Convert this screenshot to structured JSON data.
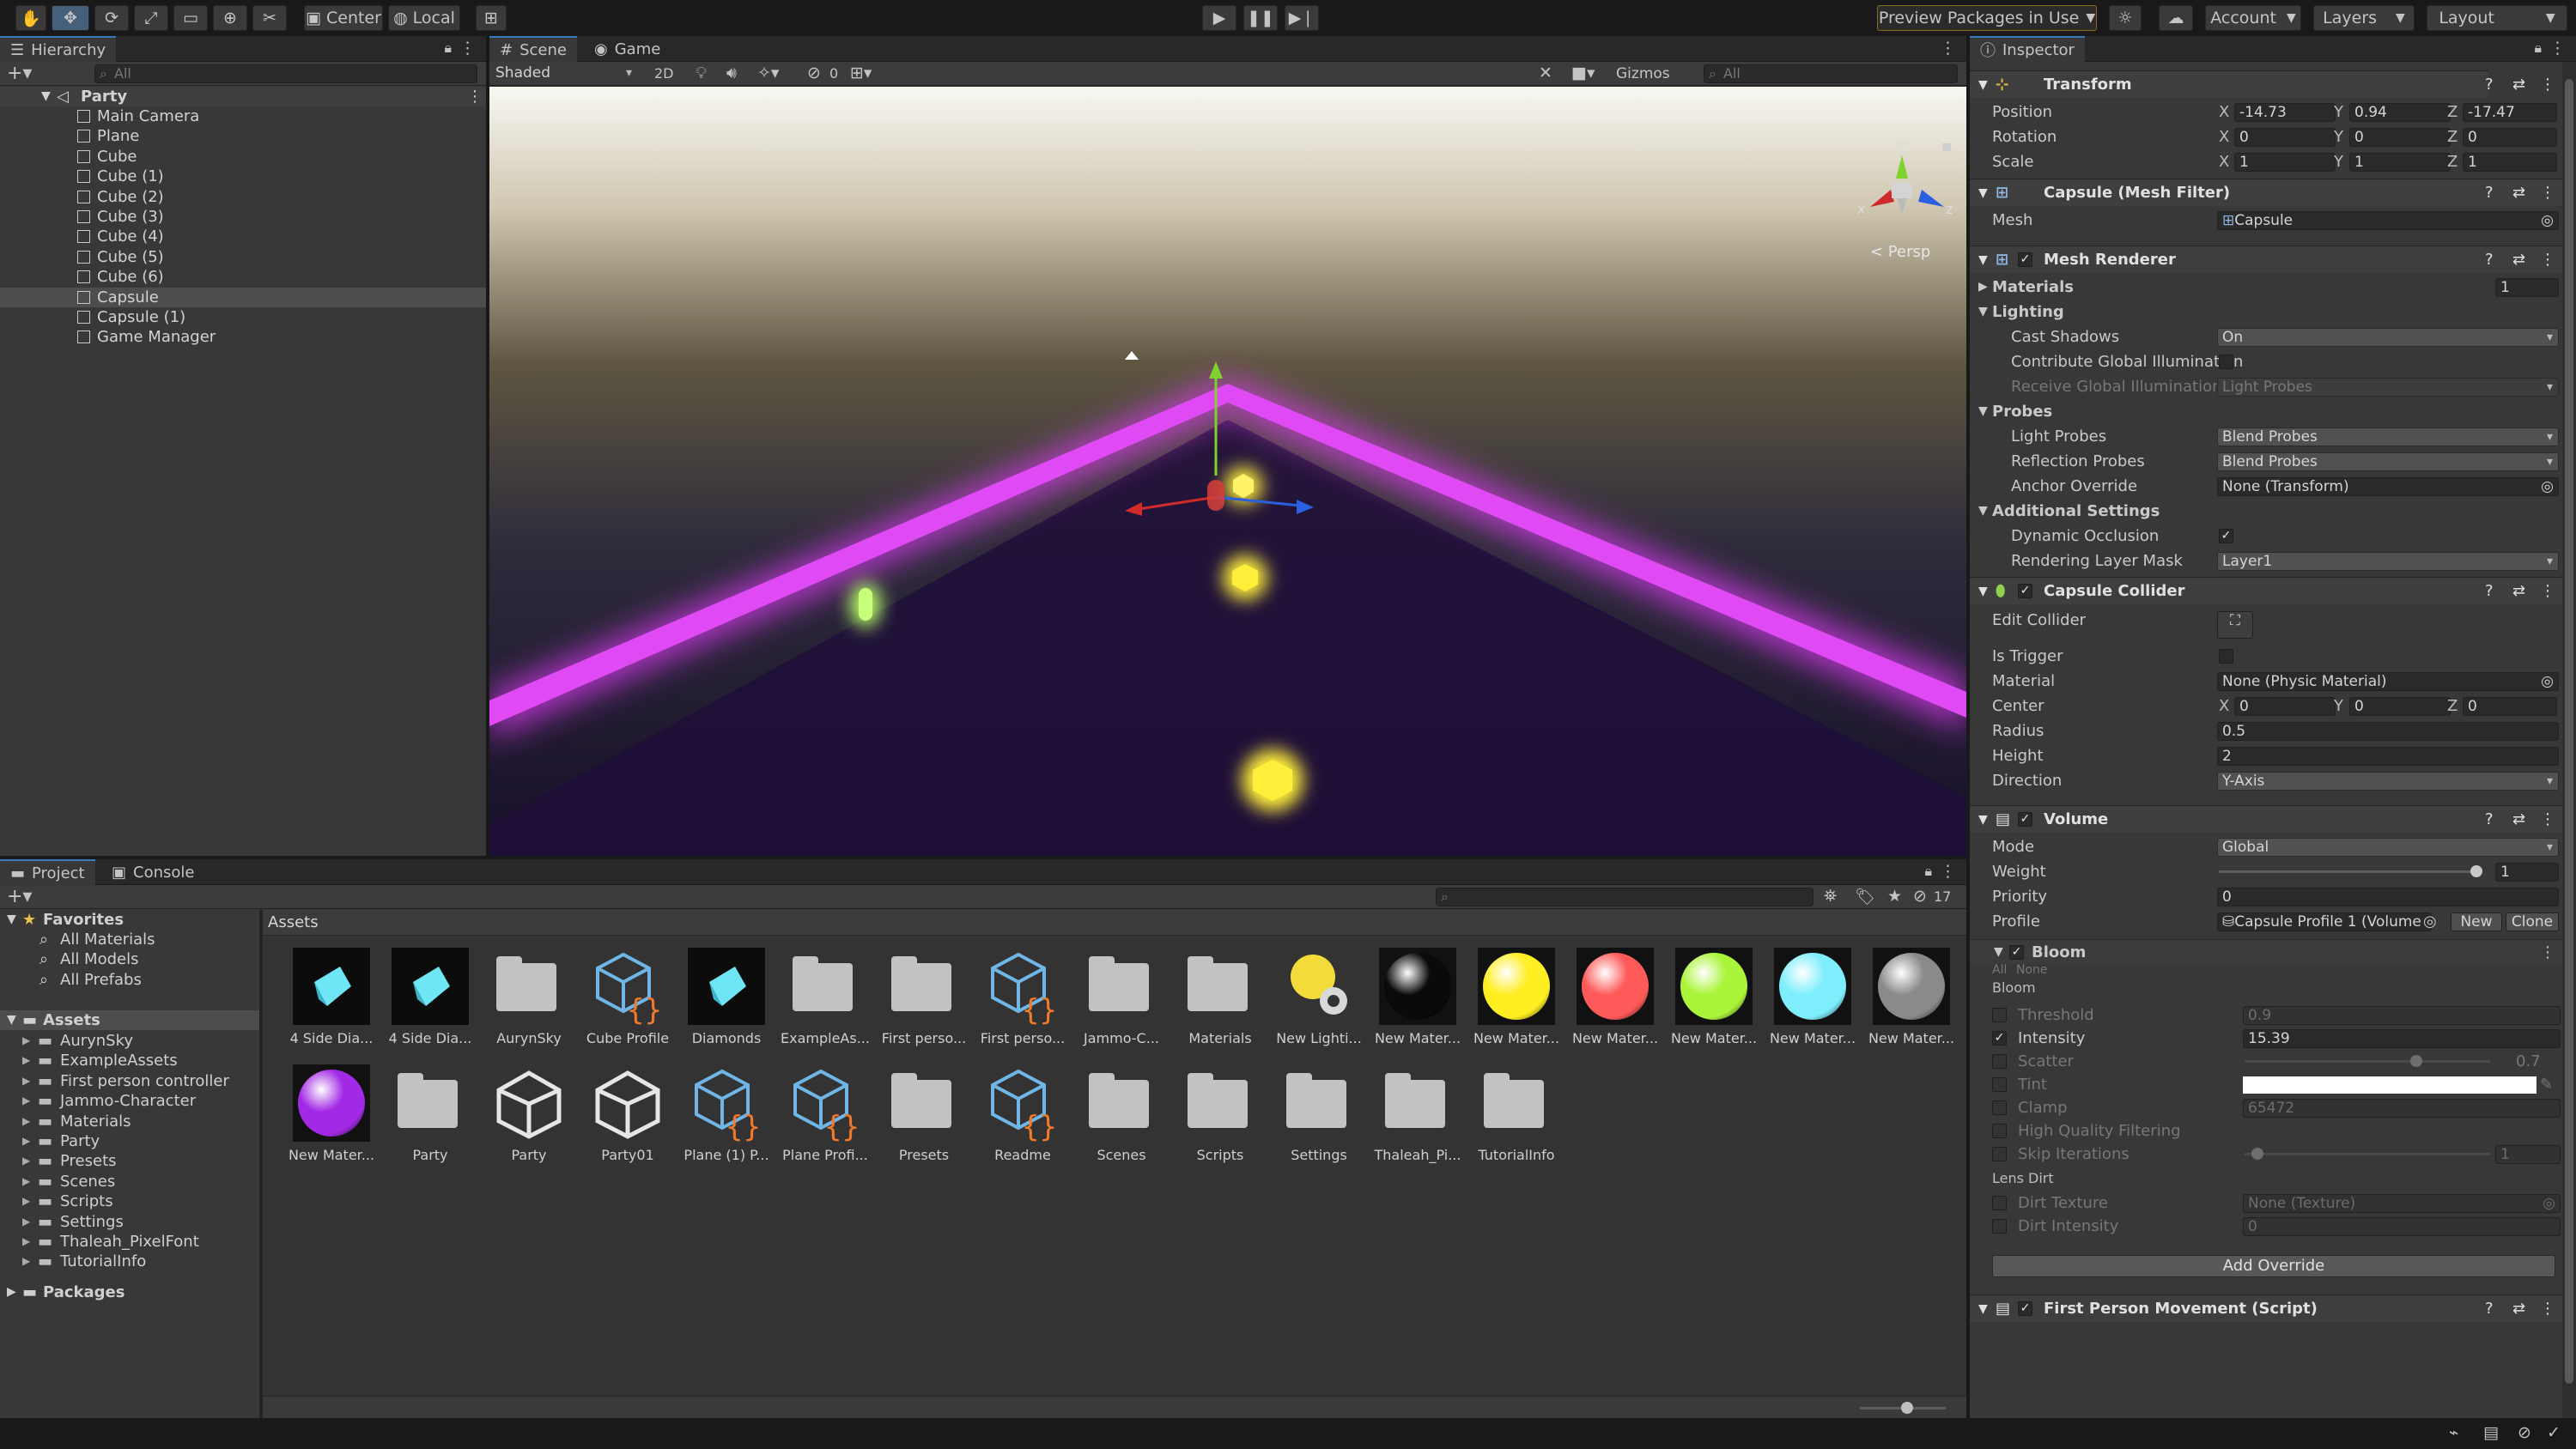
{
  "toolbar": {
    "pivot_label": "Center",
    "space_label": "Local",
    "preview_packages_label": "Preview Packages in Use",
    "account_label": "Account",
    "layers_label": "Layers",
    "layout_label": "Layout"
  },
  "hierarchy": {
    "tab_label": "Hierarchy",
    "search_placeholder": "All",
    "scene_name": "Party",
    "items": [
      {
        "label": "Main Camera"
      },
      {
        "label": "Plane"
      },
      {
        "label": "Cube"
      },
      {
        "label": "Cube (1)"
      },
      {
        "label": "Cube (2)"
      },
      {
        "label": "Cube (3)"
      },
      {
        "label": "Cube (4)"
      },
      {
        "label": "Cube (5)"
      },
      {
        "label": "Cube (6)"
      },
      {
        "label": "Capsule",
        "selected": true
      },
      {
        "label": "Capsule (1)"
      },
      {
        "label": "Game Manager"
      }
    ]
  },
  "scene_view": {
    "tabs": [
      {
        "label": "Scene"
      },
      {
        "label": "Game"
      }
    ],
    "shading_mode": "Shaded",
    "twod_label": "2D",
    "hidden_count": "0",
    "gizmos_label": "Gizmos",
    "search_placeholder": "All",
    "persp_label": "< Persp",
    "gizmo_axis_y": "y",
    "gizmo_axis_x": "x",
    "gizmo_axis_z": "z",
    "colors": {
      "neon": "#e83cff",
      "glow_yellow": "#ffef3a",
      "glow_green": "#b9ff6a"
    }
  },
  "inspector": {
    "tab_label": "Inspector",
    "transform": {
      "title": "Transform",
      "position_label": "Position",
      "position": {
        "x": "-14.73",
        "y": "0.94",
        "z": "-17.47"
      },
      "rotation_label": "Rotation",
      "rotation": {
        "x": "0",
        "y": "0",
        "z": "0"
      },
      "scale_label": "Scale",
      "scale": {
        "x": "1",
        "y": "1",
        "z": "1"
      }
    },
    "mesh_filter": {
      "title": "Capsule (Mesh Filter)",
      "mesh_label": "Mesh",
      "mesh_value": "Capsule"
    },
    "mesh_renderer": {
      "title": "Mesh Renderer",
      "materials_label": "Materials",
      "materials_count": "1",
      "lighting_label": "Lighting",
      "cast_shadows_label": "Cast Shadows",
      "cast_shadows_value": "On",
      "contribute_gi_label": "Contribute Global Illumination",
      "receive_gi_label": "Receive Global Illumination",
      "receive_gi_value": "Light Probes",
      "probes_label": "Probes",
      "light_probes_label": "Light Probes",
      "light_probes_value": "Blend Probes",
      "reflection_probes_label": "Reflection Probes",
      "reflection_probes_value": "Blend Probes",
      "anchor_override_label": "Anchor Override",
      "anchor_override_value": "None (Transform)",
      "additional_settings_label": "Additional Settings",
      "dynamic_occlusion_label": "Dynamic Occlusion",
      "rendering_layer_mask_label": "Rendering Layer Mask",
      "rendering_layer_mask_value": "Layer1"
    },
    "capsule_collider": {
      "title": "Capsule Collider",
      "edit_collider_label": "Edit Collider",
      "is_trigger_label": "Is Trigger",
      "material_label": "Material",
      "material_value": "None (Physic Material)",
      "center_label": "Center",
      "center": {
        "x": "0",
        "y": "0",
        "z": "0"
      },
      "radius_label": "Radius",
      "radius_value": "0.5",
      "height_label": "Height",
      "height_value": "2",
      "direction_label": "Direction",
      "direction_value": "Y-Axis"
    },
    "volume": {
      "title": "Volume",
      "mode_label": "Mode",
      "mode_value": "Global",
      "weight_label": "Weight",
      "weight_value": "1",
      "weight_fraction": 1,
      "priority_label": "Priority",
      "priority_value": "0",
      "profile_label": "Profile",
      "profile_value": "Capsule Profile 1 (Volume",
      "new_label": "New",
      "clone_label": "Clone"
    },
    "bloom": {
      "title": "Bloom",
      "all_label": "All",
      "none_label": "None",
      "section_label": "Bloom",
      "threshold_label": "Threshold",
      "threshold_value": "0.9",
      "intensity_label": "Intensity",
      "intensity_value": "15.39",
      "scatter_label": "Scatter",
      "scatter_value": "0.7",
      "scatter_fraction": 0.7,
      "tint_label": "Tint",
      "tint_color": "#ffffff",
      "clamp_label": "Clamp",
      "clamp_value": "65472",
      "hq_filtering_label": "High Quality Filtering",
      "skip_iterations_label": "Skip Iterations",
      "skip_iterations_value": "1",
      "lens_dirt_label": "Lens Dirt",
      "dirt_texture_label": "Dirt Texture",
      "dirt_texture_value": "None (Texture)",
      "dirt_intensity_label": "Dirt Intensity",
      "dirt_intensity_value": "0"
    },
    "add_override_label": "Add Override",
    "script": {
      "title": "First Person Movement (Script)"
    }
  },
  "project": {
    "tabs": [
      {
        "label": "Project"
      },
      {
        "label": "Console"
      }
    ],
    "hidden_count": "17",
    "breadcrumb": "Assets",
    "favorites_label": "Favorites",
    "favorites": [
      {
        "label": "All Materials"
      },
      {
        "label": "All Models"
      },
      {
        "label": "All Prefabs"
      }
    ],
    "assets_label": "Assets",
    "folders": [
      {
        "label": "AurynSky"
      },
      {
        "label": "ExampleAssets"
      },
      {
        "label": "First person controller"
      },
      {
        "label": "Jammo-Character"
      },
      {
        "label": "Materials"
      },
      {
        "label": "Party"
      },
      {
        "label": "Presets"
      },
      {
        "label": "Scenes"
      },
      {
        "label": "Scripts"
      },
      {
        "label": "Settings"
      },
      {
        "label": "Thaleah_PixelFont"
      },
      {
        "label": "TutorialInfo"
      }
    ],
    "packages_label": "Packages",
    "assets": [
      {
        "label": "4 Side Dia...",
        "kind": "diamond"
      },
      {
        "label": "4 Side Dia...",
        "kind": "diamond"
      },
      {
        "label": "AurynSky",
        "kind": "folder"
      },
      {
        "label": "Cube Profile",
        "kind": "profile"
      },
      {
        "label": "Diamonds",
        "kind": "diamond"
      },
      {
        "label": "ExampleAs...",
        "kind": "folder"
      },
      {
        "label": "First perso...",
        "kind": "folder"
      },
      {
        "label": "First perso...",
        "kind": "profile"
      },
      {
        "label": "Jammo-C...",
        "kind": "folder"
      },
      {
        "label": "Materials",
        "kind": "folder"
      },
      {
        "label": "New Lighti...",
        "kind": "lighting"
      },
      {
        "label": "New Mater...",
        "kind": "sphere",
        "color": "#0a0a0a"
      },
      {
        "label": "New Mater...",
        "kind": "sphere",
        "color": "#ffee22"
      },
      {
        "label": "New Mater...",
        "kind": "sphere",
        "color": "#ff5a5a"
      },
      {
        "label": "New Mater...",
        "kind": "sphere",
        "color": "#aaf53a"
      },
      {
        "label": "New Mater...",
        "kind": "sphere",
        "color": "#7eeefc"
      },
      {
        "label": "New Mater...",
        "kind": "sphere",
        "color": "#8a8a8a"
      },
      {
        "label": "New Mater...",
        "kind": "sphere",
        "color": "#a22ae6"
      },
      {
        "label": "Party",
        "kind": "folder"
      },
      {
        "label": "Party",
        "kind": "unity"
      },
      {
        "label": "Party01",
        "kind": "unity"
      },
      {
        "label": "Plane (1) P...",
        "kind": "profile"
      },
      {
        "label": "Plane Profi...",
        "kind": "profile"
      },
      {
        "label": "Presets",
        "kind": "folder"
      },
      {
        "label": "Readme",
        "kind": "profile"
      },
      {
        "label": "Scenes",
        "kind": "folder"
      },
      {
        "label": "Scripts",
        "kind": "folder"
      },
      {
        "label": "Settings",
        "kind": "folder"
      },
      {
        "label": "Thaleah_Pi...",
        "kind": "folder"
      },
      {
        "label": "TutorialInfo",
        "kind": "folder"
      }
    ],
    "zoom_fraction": 0.55
  }
}
